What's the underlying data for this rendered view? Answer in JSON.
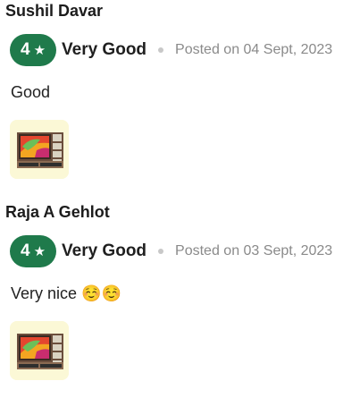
{
  "reviews": [
    {
      "name": "Sushil Davar",
      "rating": "4",
      "star_icon": "star-icon",
      "rating_label": "Very Good",
      "posted": "Posted on 04 Sept, 2023",
      "text": "Good",
      "image": "product-thumbnail-tv-unit"
    },
    {
      "name": "Raja A Gehlot",
      "rating": "4",
      "star_icon": "star-icon",
      "rating_label": "Very Good",
      "posted": "Posted on 03 Sept, 2023",
      "text": "Very nice ☺️☺️",
      "image": "product-thumbnail-tv-unit"
    }
  ],
  "colors": {
    "badge_green": "#1f7a4b",
    "muted_text": "#8a8a8a",
    "thumb_bg": "#fbf8d6"
  }
}
